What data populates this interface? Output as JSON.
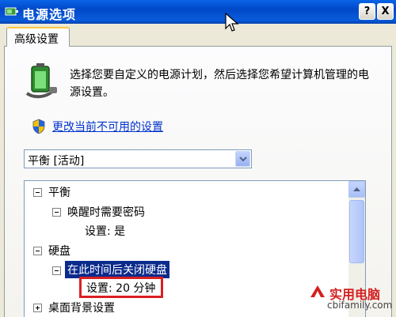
{
  "window": {
    "title": "电源选项",
    "help_label": "?",
    "close_label": "X"
  },
  "tabs": [
    {
      "label": "高级设置",
      "active": true
    }
  ],
  "description": "选择您要自定义的电源计划，然后选择您希望计算机管理的电源设置。",
  "link": {
    "label": "更改当前不可用的设置"
  },
  "plan_select": {
    "value": "平衡 [活动]"
  },
  "tree": {
    "items": [
      {
        "label": "平衡",
        "level": 0,
        "expander": "minus"
      },
      {
        "label": "唤醒时需要密码",
        "level": 1,
        "expander": "minus"
      },
      {
        "label": "设置: 是",
        "level": 2
      },
      {
        "label": "硬盘",
        "level": 0,
        "expander": "minus"
      },
      {
        "label": "在此时间后关闭硬盘",
        "level": 1,
        "expander": "minus",
        "selected": true
      },
      {
        "label": "设置: 20 分钟",
        "level": 2,
        "highlighted": true
      },
      {
        "label": "桌面背景设置",
        "level": 0,
        "expander": "plus"
      }
    ]
  },
  "watermark": {
    "title": "实用电脑",
    "url": "cbifamily.com"
  },
  "colors": {
    "titlebar": "#0a5cdc",
    "selection": "#0a2a8c",
    "highlight_border": "#d92020",
    "link": "#0033cc"
  }
}
